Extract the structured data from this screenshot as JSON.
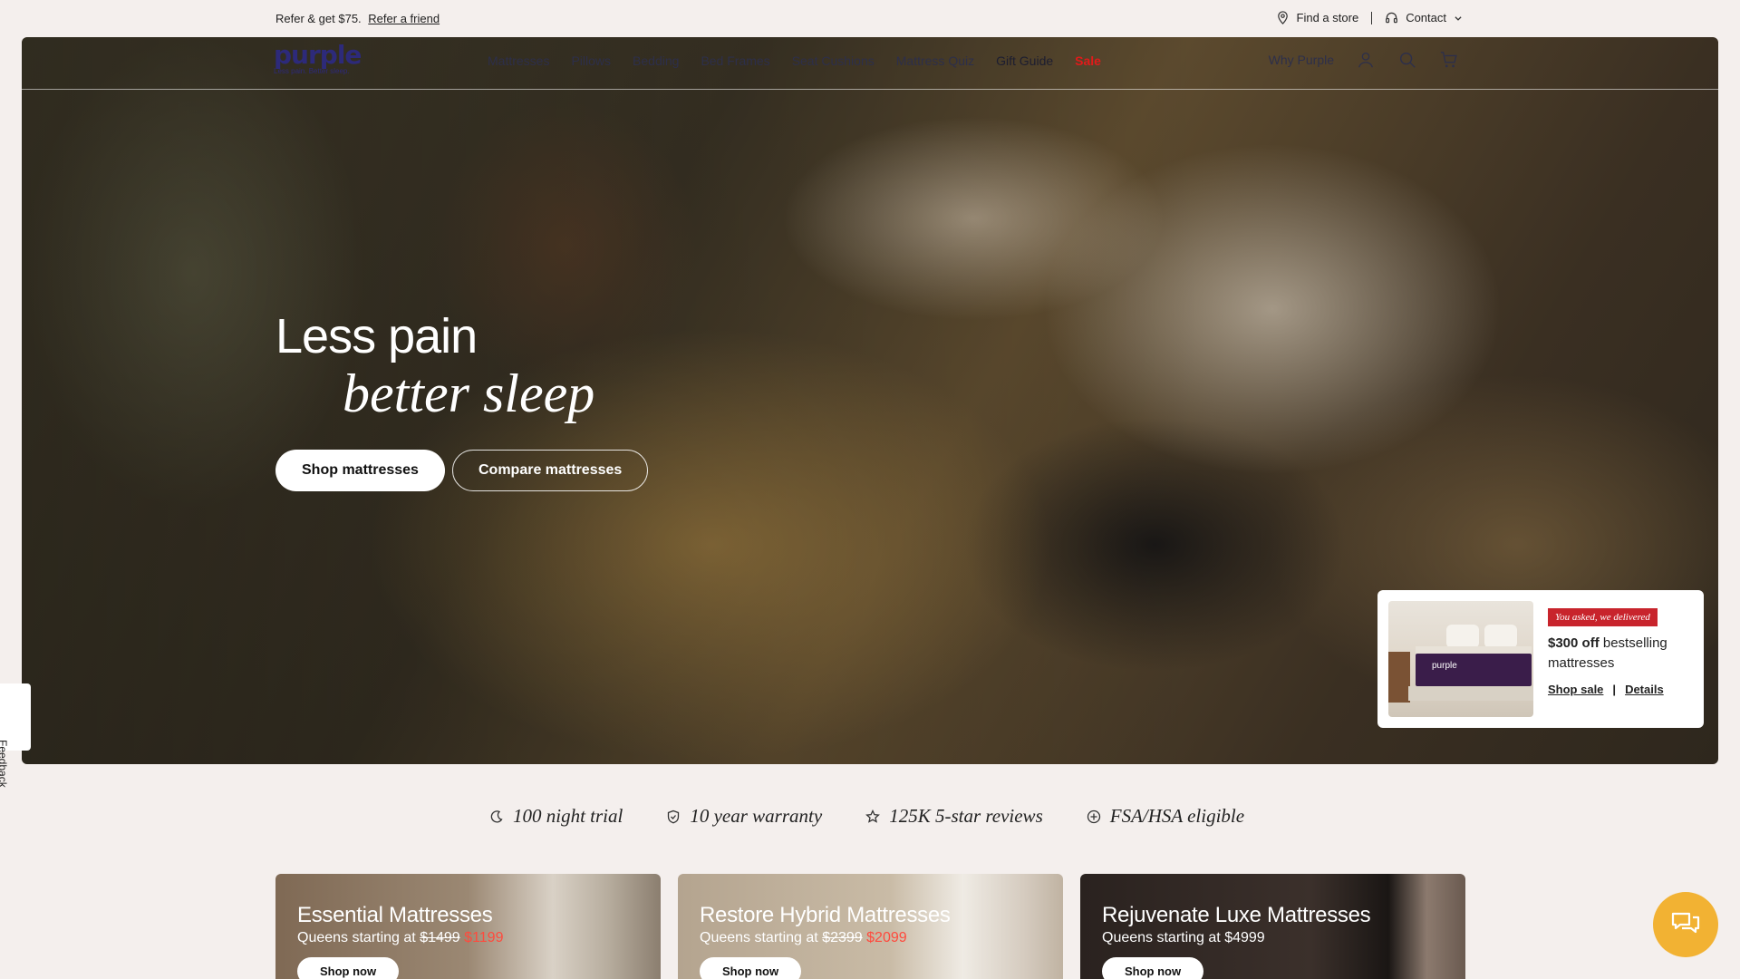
{
  "utility": {
    "refer_text": "Refer & get $75.",
    "refer_link": "Refer a friend",
    "find_store": "Find a store",
    "contact": "Contact"
  },
  "nav": {
    "logo": "purple",
    "logo_tagline": "Less pain. Better sleep.",
    "links": [
      "Mattresses",
      "Pillows",
      "Bedding",
      "Bed Frames",
      "Seat Cushions",
      "Mattress Quiz",
      "Gift Guide",
      "Sale"
    ],
    "why": "Why Purple"
  },
  "hero": {
    "title_line1": "Less pain",
    "title_line2": "better sleep",
    "shop_button": "Shop mattresses",
    "compare_button": "Compare mattresses"
  },
  "promo": {
    "badge": "You asked, we delivered",
    "amount": "$300 off",
    "text": "bestselling mattresses",
    "shop_link": "Shop sale",
    "separator": "|",
    "details_link": "Details",
    "image_brand": "purple"
  },
  "feedback": "Feedback",
  "props": [
    "100 night trial",
    "10 year warranty",
    "125K 5-star reviews",
    "FSA/HSA eligible"
  ],
  "cards": [
    {
      "title": "Essential Mattresses",
      "sub": "Queens starting at",
      "old_price": "$1499",
      "new_price": "$1199",
      "button": "Shop now"
    },
    {
      "title": "Restore Hybrid Mattresses",
      "sub": "Queens starting at",
      "old_price": "$2399",
      "new_price": "$2099",
      "button": "Shop now"
    },
    {
      "title": "Rejuvenate Luxe Mattresses",
      "sub": "Queens starting at $4999",
      "button": "Shop now"
    }
  ],
  "colors": {
    "sale": "#e21a1a",
    "chat": "#f2b233",
    "badge": "#c8242c",
    "logo": "#2d2a7a"
  }
}
